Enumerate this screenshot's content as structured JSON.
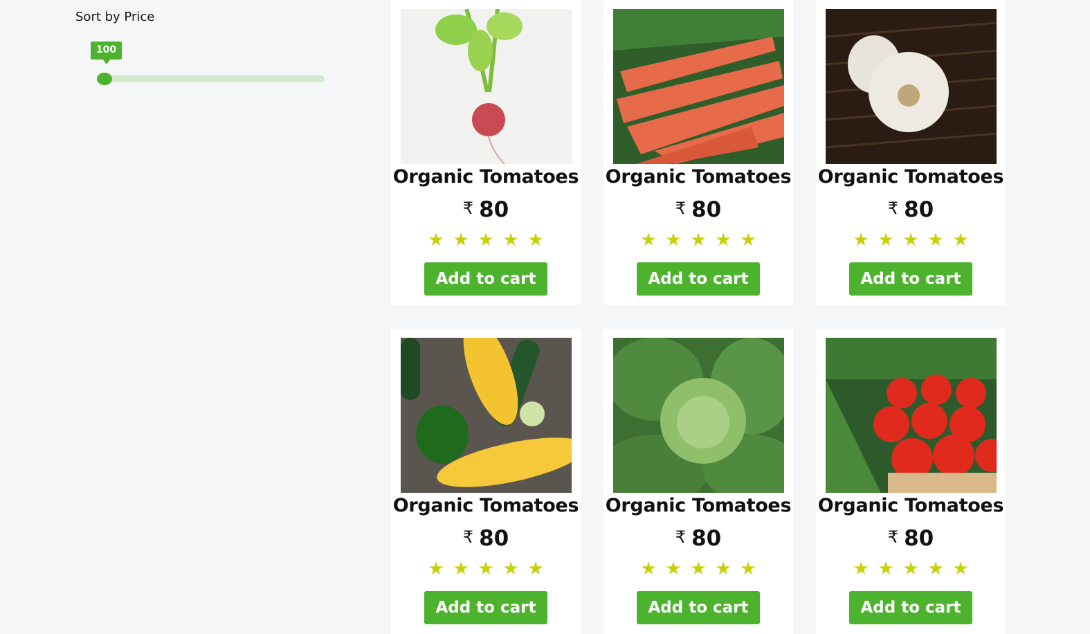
{
  "filter": {
    "sort_label": "Sort by Price",
    "price_value": "100",
    "price_fraction": 0.03
  },
  "products": [
    {
      "name": "Organic Tomatoes",
      "currency": "₹",
      "price": "80",
      "rating": 5,
      "button": "Add to cart",
      "image": "radish"
    },
    {
      "name": "Organic Tomatoes",
      "currency": "₹",
      "price": "80",
      "rating": 5,
      "button": "Add to cart",
      "image": "carrots"
    },
    {
      "name": "Organic Tomatoes",
      "currency": "₹",
      "price": "80",
      "rating": 5,
      "button": "Add to cart",
      "image": "garlic"
    },
    {
      "name": "Organic Tomatoes",
      "currency": "₹",
      "price": "80",
      "rating": 5,
      "button": "Add to cart",
      "image": "corn"
    },
    {
      "name": "Organic Tomatoes",
      "currency": "₹",
      "price": "80",
      "rating": 5,
      "button": "Add to cart",
      "image": "cabbage"
    },
    {
      "name": "Organic Tomatoes",
      "currency": "₹",
      "price": "80",
      "rating": 5,
      "button": "Add to cart",
      "image": "tomatoes"
    }
  ],
  "colors": {
    "accent": "#4db32f",
    "star": "#c8d00a",
    "background": "#f5f6f8"
  }
}
